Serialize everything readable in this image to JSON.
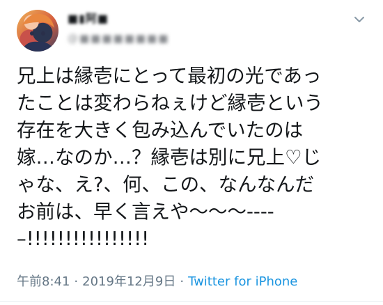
{
  "user": {
    "display_name": "■▮阿■",
    "handle": "@■■■■■■■■",
    "avatar_icon": "anime-avatar"
  },
  "tweet": {
    "lines": [
      "兄上は縁壱にとって最初の光であっ",
      "たことは変わらねぇけど縁壱という",
      "存在を大きく包み込んでいたのは",
      "嫁…なのか…？縁壱は別に兄上♡じ",
      "ゃな、え?、何、この、なんなんだ",
      "お前は、早く言えや〜〜〜----",
      "–!!!!!!!!!!!!!!!!"
    ]
  },
  "meta": {
    "time": "午前8:41",
    "separator": "·",
    "date": "2019年12月9日",
    "source": "Twitter for iPhone"
  },
  "colors": {
    "text": "#14171a",
    "secondary": "#657786",
    "link": "#1b95e0"
  }
}
